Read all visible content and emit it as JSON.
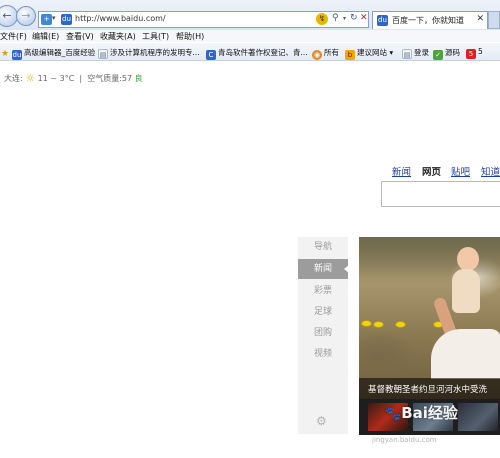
{
  "browser": {
    "url": "http://www.baidu.com/",
    "tab_title": "百度一下，你就知道",
    "tab_close": "✕",
    "new_tab": ""
  },
  "icons": {
    "back": "←",
    "forward": "→",
    "site": "du",
    "dropdown": "▾",
    "compat": "↯",
    "search": "⚲",
    "refresh": "↻",
    "stop": "✕",
    "favorites_star": "★",
    "sun": "☼",
    "gear": "⚙"
  },
  "menu": [
    "文件(F)",
    "编辑(E)",
    "查看(V)",
    "收藏夹(A)",
    "工具(T)",
    "帮助(H)"
  ],
  "favorites": [
    {
      "label": "高级编辑器_百度经验",
      "icon": "du"
    },
    {
      "label": "涉及计算机程序的发明专...",
      "icon": "▤"
    },
    {
      "label": "青岛软件著作权登记、青...",
      "icon": "C"
    },
    {
      "label": "所有",
      "icon": "◉"
    },
    {
      "label": "建议网站 ▾",
      "icon": "b"
    },
    {
      "label": "登录",
      "icon": "▤"
    },
    {
      "label": "源码",
      "icon": "✓"
    },
    {
      "label": "5",
      "icon": "5"
    }
  ],
  "weather": {
    "city": "大连:",
    "temp": "11 ~ 3°C",
    "separator": "|",
    "aqi_label": "空气质量:57",
    "aqi_level": "良"
  },
  "topnav": {
    "news": "新闻",
    "web": "网页",
    "tieba": "贴吧",
    "zhidao": "知道"
  },
  "sidenav": [
    "导航",
    "新闻",
    "彩票",
    "足球",
    "团购",
    "视频"
  ],
  "news": {
    "caption": "基督教朝圣者约旦河河水中受洗"
  },
  "watermark": {
    "paw": "🐾",
    "text": "Bai经验",
    "url": "jingyan.baidu.com"
  },
  "colors": {
    "link": "#1c3ea9",
    "aqi_good": "#3ca03c",
    "side_active": "#9c9c9c"
  }
}
